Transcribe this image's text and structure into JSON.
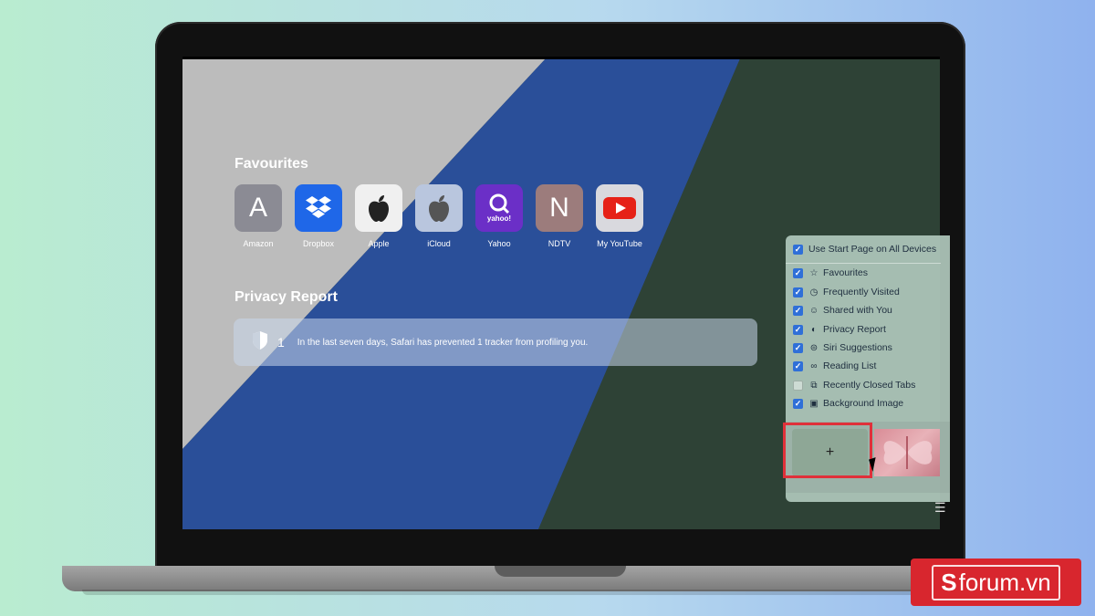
{
  "favourites": {
    "title": "Favourites",
    "items": [
      {
        "label": "Amazon",
        "glyph": "A",
        "icon": "amazon-letter-icon",
        "color": "#8b8b94"
      },
      {
        "label": "Dropbox",
        "glyph": "",
        "icon": "dropbox-icon",
        "color": "#1f67e8"
      },
      {
        "label": "Apple",
        "glyph": "",
        "icon": "apple-logo-icon",
        "color": "#f0f0f0"
      },
      {
        "label": "iCloud",
        "glyph": "",
        "icon": "apple-logo-icon",
        "color": "#b9c6de"
      },
      {
        "label": "Yahoo",
        "glyph": "",
        "icon": "yahoo-icon",
        "color": "#6b2fc7"
      },
      {
        "label": "NDTV",
        "glyph": "N",
        "icon": "ndtv-letter-icon",
        "color": "#9c7c7c"
      },
      {
        "label": "My YouTube",
        "glyph": "",
        "icon": "youtube-icon",
        "color": "#d9d9de"
      }
    ]
  },
  "privacy": {
    "title": "Privacy Report",
    "count": "1",
    "message": "In the last seven days, Safari has prevented 1 tracker from profiling you."
  },
  "customize": {
    "use_all_devices": "Use Start Page on All Devices",
    "options": [
      {
        "label": "Favourites",
        "icon": "star-icon",
        "checked": true
      },
      {
        "label": "Frequently Visited",
        "icon": "clock-icon",
        "checked": true
      },
      {
        "label": "Shared with You",
        "icon": "people-icon",
        "checked": true
      },
      {
        "label": "Privacy Report",
        "icon": "shield-half-icon",
        "checked": true
      },
      {
        "label": "Siri Suggestions",
        "icon": "siri-icon",
        "checked": true
      },
      {
        "label": "Reading List",
        "icon": "glasses-icon",
        "checked": true
      },
      {
        "label": "Recently Closed Tabs",
        "icon": "tabs-icon",
        "checked": false
      },
      {
        "label": "Background Image",
        "icon": "image-icon",
        "checked": true
      }
    ],
    "add_label": "+"
  },
  "brand": {
    "prefix": "S",
    "name": "forum.vn"
  },
  "colors": {
    "accent": "#2f6fd8",
    "highlight": "#e0303a",
    "brand": "#d8262e"
  }
}
